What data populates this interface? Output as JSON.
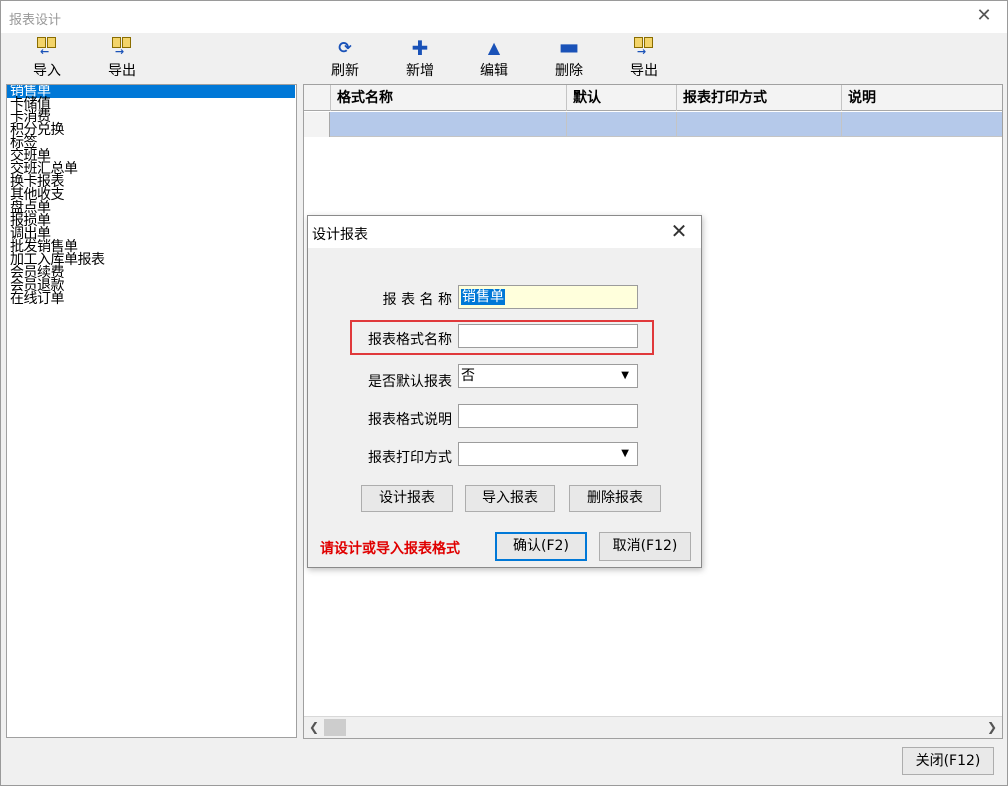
{
  "window": {
    "title": "报表设计",
    "close_glyph": "✕"
  },
  "toolbar": {
    "import_label": "导入",
    "export_left_label": "导出",
    "refresh_label": "刷新",
    "add_label": "新增",
    "edit_label": "编辑",
    "delete_label": "删除",
    "export_right_label": "导出",
    "icons": {
      "import": "import-icon",
      "export": "export-icon",
      "refresh": "refresh-icon",
      "add": "plus-icon",
      "edit": "triangle-up-icon",
      "delete": "minus-icon"
    },
    "icon_color": "#1a52b8"
  },
  "report_list": {
    "selected_index": 0,
    "items": [
      "销售单",
      "卡储值",
      "卡消费",
      "积分兑换",
      "标签",
      "交班单",
      "交班汇总单",
      "换卡报表",
      "其他收支",
      "盘点单",
      "报损单",
      "调出单",
      "批发销售单",
      "加工入库单报表",
      "会员续费",
      "会员退款",
      "在线订单"
    ]
  },
  "grid": {
    "columns": [
      "格式名称",
      "默认",
      "报表打印方式",
      "说明"
    ]
  },
  "footer": {
    "close_label": "关闭(F12)"
  },
  "dialog": {
    "title": "设计报表",
    "close_glyph": "✕",
    "fields": {
      "name_label": "报 表 名 称",
      "name_value": "销售单",
      "format_name_label": "报表格式名称",
      "format_name_value": "",
      "default_label": "是否默认报表",
      "default_value": "否",
      "format_desc_label": "报表格式说明",
      "format_desc_value": "",
      "print_mode_label": "报表打印方式",
      "print_mode_value": ""
    },
    "buttons": {
      "design": "设计报表",
      "import": "导入报表",
      "delete": "删除报表",
      "confirm": "确认(F2)",
      "cancel": "取消(F12)"
    },
    "warning": "请设计或导入报表格式",
    "colors": {
      "warning": "#e00000",
      "highlight_border": "#e0393b",
      "selection": "#0078d7"
    }
  }
}
